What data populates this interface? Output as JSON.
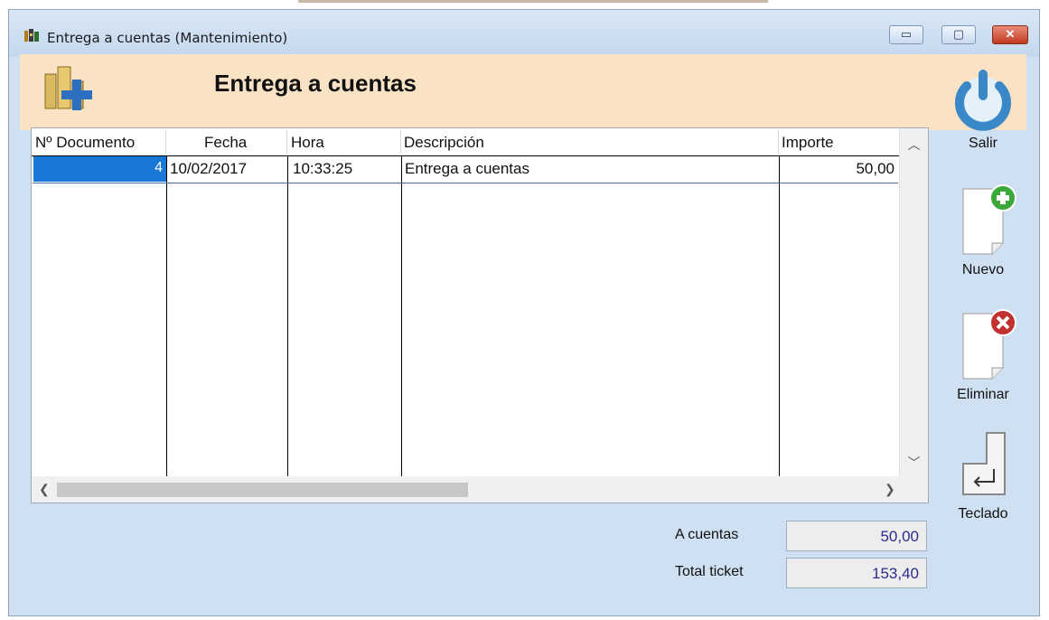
{
  "window": {
    "title": "Entrega a cuentas (Mantenimiento)",
    "controls": {
      "minimize": "▭",
      "maximize": "▢",
      "close": "✕"
    }
  },
  "header": {
    "title": "Entrega a cuentas",
    "icon": "coins-plus-icon"
  },
  "actions": {
    "salir": {
      "label": "Salir",
      "icon": "power-icon"
    },
    "nuevo": {
      "label": "Nuevo",
      "icon": "new-document-icon"
    },
    "eliminar": {
      "label": "Eliminar",
      "icon": "delete-document-icon"
    },
    "teclado": {
      "label": "Teclado",
      "icon": "keyboard-enter-icon"
    }
  },
  "grid": {
    "columns": [
      "Nº Documento",
      "Fecha",
      "Hora",
      "Descripción",
      "Importe"
    ],
    "rows": [
      {
        "doc": "4",
        "fecha": "10/02/2017",
        "hora": "10:33:25",
        "descripcion": "Entrega a cuentas",
        "importe": "50,00"
      }
    ]
  },
  "summary": {
    "a_cuentas": {
      "label": "A cuentas",
      "value": "50,00"
    },
    "total_ticket": {
      "label": "Total ticket",
      "value": "153,40"
    }
  },
  "colors": {
    "selection": "#1778d6",
    "header_band": "#fae3c4",
    "window_bg": "#cfe0f2"
  }
}
